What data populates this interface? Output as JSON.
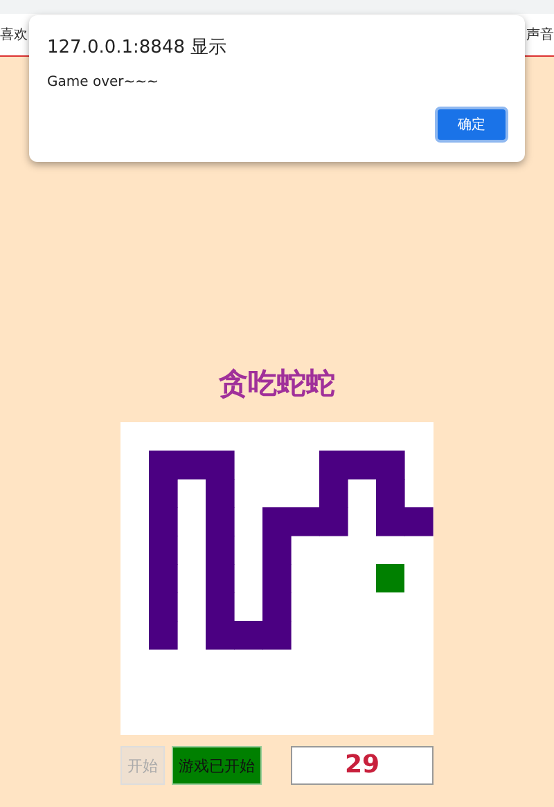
{
  "page_tabs": [
    "喜欢",
    "声音"
  ],
  "dialog": {
    "title": "127.0.0.1:8848 显示",
    "message": "Game over~~~",
    "button": "确定"
  },
  "title": "贪吃蛇蛇",
  "board": {
    "rows": [
      [
        {
          "kind": "empty"
        },
        {
          "kind": "empty"
        },
        {
          "kind": "empty"
        },
        {
          "kind": "empty"
        },
        {
          "kind": "empty"
        },
        {
          "kind": "empty"
        },
        {
          "kind": "empty"
        },
        {
          "kind": "empty"
        },
        {
          "kind": "empty"
        },
        {
          "kind": "empty"
        },
        {
          "kind": "empty"
        }
      ],
      [
        {
          "kind": "empty"
        },
        {
          "kind": "snake"
        },
        {
          "kind": "snake"
        },
        {
          "kind": "snake"
        },
        {
          "kind": "empty"
        },
        {
          "kind": "empty"
        },
        {
          "kind": "empty"
        },
        {
          "kind": "snake"
        },
        {
          "kind": "snake"
        },
        {
          "kind": "snake"
        },
        {
          "kind": "empty"
        }
      ],
      [
        {
          "kind": "empty"
        },
        {
          "kind": "snake"
        },
        {
          "kind": "empty"
        },
        {
          "kind": "snake"
        },
        {
          "kind": "empty"
        },
        {
          "kind": "empty"
        },
        {
          "kind": "empty"
        },
        {
          "kind": "snake"
        },
        {
          "kind": "empty"
        },
        {
          "kind": "snake"
        },
        {
          "kind": "empty"
        }
      ],
      [
        {
          "kind": "empty"
        },
        {
          "kind": "snake"
        },
        {
          "kind": "empty"
        },
        {
          "kind": "snake"
        },
        {
          "kind": "empty"
        },
        {
          "kind": "snake"
        },
        {
          "kind": "snake"
        },
        {
          "kind": "snake"
        },
        {
          "kind": "empty"
        },
        {
          "kind": "snake"
        },
        {
          "kind": "snake"
        }
      ],
      [
        {
          "kind": "empty"
        },
        {
          "kind": "snake"
        },
        {
          "kind": "empty"
        },
        {
          "kind": "snake"
        },
        {
          "kind": "empty"
        },
        {
          "kind": "snake"
        },
        {
          "kind": "empty"
        },
        {
          "kind": "empty"
        },
        {
          "kind": "empty"
        },
        {
          "kind": "empty"
        },
        {
          "kind": "empty"
        }
      ],
      [
        {
          "kind": "empty"
        },
        {
          "kind": "snake"
        },
        {
          "kind": "empty"
        },
        {
          "kind": "snake"
        },
        {
          "kind": "empty"
        },
        {
          "kind": "snake"
        },
        {
          "kind": "empty"
        },
        {
          "kind": "empty"
        },
        {
          "kind": "empty"
        },
        {
          "kind": "food"
        },
        {
          "kind": "empty"
        }
      ],
      [
        {
          "kind": "empty"
        },
        {
          "kind": "snake"
        },
        {
          "kind": "empty"
        },
        {
          "kind": "snake"
        },
        {
          "kind": "empty"
        },
        {
          "kind": "snake"
        },
        {
          "kind": "empty"
        },
        {
          "kind": "empty"
        },
        {
          "kind": "empty"
        },
        {
          "kind": "empty"
        },
        {
          "kind": "empty"
        }
      ],
      [
        {
          "kind": "empty"
        },
        {
          "kind": "snake"
        },
        {
          "kind": "empty"
        },
        {
          "kind": "snake"
        },
        {
          "kind": "snake"
        },
        {
          "kind": "snake"
        },
        {
          "kind": "empty"
        },
        {
          "kind": "empty"
        },
        {
          "kind": "empty"
        },
        {
          "kind": "empty"
        },
        {
          "kind": "empty"
        }
      ],
      [
        {
          "kind": "empty"
        },
        {
          "kind": "empty"
        },
        {
          "kind": "empty"
        },
        {
          "kind": "empty"
        },
        {
          "kind": "empty"
        },
        {
          "kind": "empty"
        },
        {
          "kind": "empty"
        },
        {
          "kind": "empty"
        },
        {
          "kind": "empty"
        },
        {
          "kind": "empty"
        },
        {
          "kind": "empty"
        }
      ],
      [
        {
          "kind": "empty"
        },
        {
          "kind": "empty"
        },
        {
          "kind": "empty"
        },
        {
          "kind": "empty"
        },
        {
          "kind": "empty"
        },
        {
          "kind": "empty"
        },
        {
          "kind": "empty"
        },
        {
          "kind": "empty"
        },
        {
          "kind": "empty"
        },
        {
          "kind": "empty"
        },
        {
          "kind": "empty"
        }
      ],
      [
        {
          "kind": "empty"
        },
        {
          "kind": "empty"
        },
        {
          "kind": "empty"
        },
        {
          "kind": "empty"
        },
        {
          "kind": "empty"
        },
        {
          "kind": "empty"
        },
        {
          "kind": "empty"
        },
        {
          "kind": "empty"
        },
        {
          "kind": "empty"
        },
        {
          "kind": "empty"
        },
        {
          "kind": "empty"
        }
      ]
    ]
  },
  "controls": [
    {
      "kind": "button",
      "label": "开始",
      "disabled": true
    },
    {
      "kind": "button",
      "label": "游戏已开始",
      "disabled": false
    },
    {
      "kind": "score",
      "label": "29"
    }
  ]
}
